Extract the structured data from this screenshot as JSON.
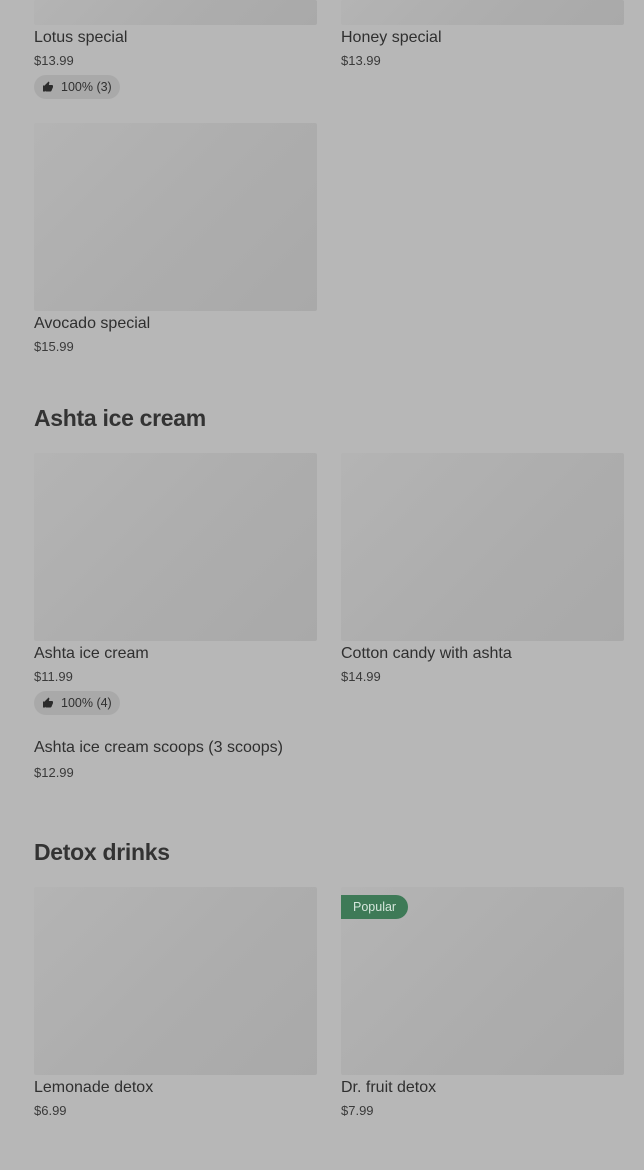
{
  "items": {
    "lotus": {
      "name": "Lotus special",
      "price": "$13.99",
      "rating": "100% (3)"
    },
    "honey": {
      "name": "Honey special",
      "price": "$13.99"
    },
    "avocado": {
      "name": "Avocado special",
      "price": "$15.99"
    },
    "ashta": {
      "name": "Ashta ice cream",
      "price": "$11.99",
      "rating": "100% (4)"
    },
    "cotton": {
      "name": "Cotton candy with ashta",
      "price": "$14.99"
    },
    "scoops": {
      "name": "Ashta ice cream scoops (3 scoops)",
      "price": "$12.99"
    },
    "lemonade": {
      "name": "Lemonade detox",
      "price": "$6.99"
    },
    "drfruit": {
      "name": "Dr. fruit detox",
      "price": "$7.99",
      "badge": "Popular"
    }
  },
  "sections": {
    "ashta": {
      "title": "Ashta ice cream"
    },
    "detox": {
      "title": "Detox drinks"
    }
  },
  "colors": {
    "overlay_background": "#b7b7b7",
    "popular_badge": "#3e7a57"
  },
  "icons": {
    "rating": "thumbs-up-icon"
  }
}
